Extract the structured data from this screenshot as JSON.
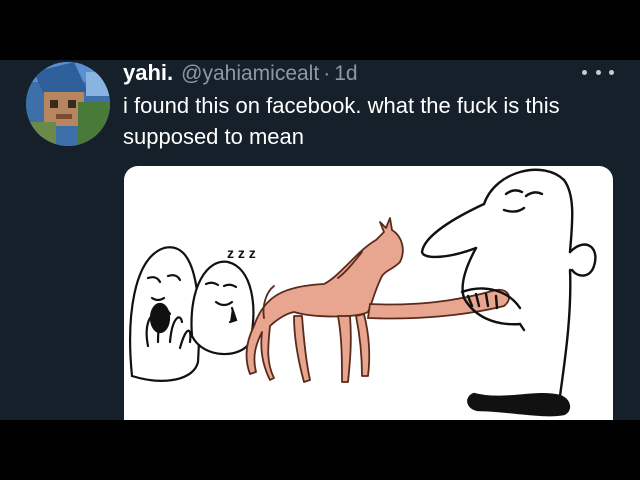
{
  "tweet": {
    "display_name": "yahi.",
    "handle": "@yahiamicealt",
    "separator": "·",
    "time": "1d",
    "text": "i found this on facebook. what the fuck is this supposed to mean",
    "avatar_icon": "minecraft-skin-avatar",
    "more_icon": "more-options-icon",
    "media_description_icon": "cartoon-illustration-image"
  },
  "illustration": {
    "sleep_text": "z z z"
  },
  "colors": {
    "background": "#15202b",
    "primary_text": "#ffffff",
    "secondary_text": "#8b98a5",
    "horse": "#e8a58f"
  }
}
